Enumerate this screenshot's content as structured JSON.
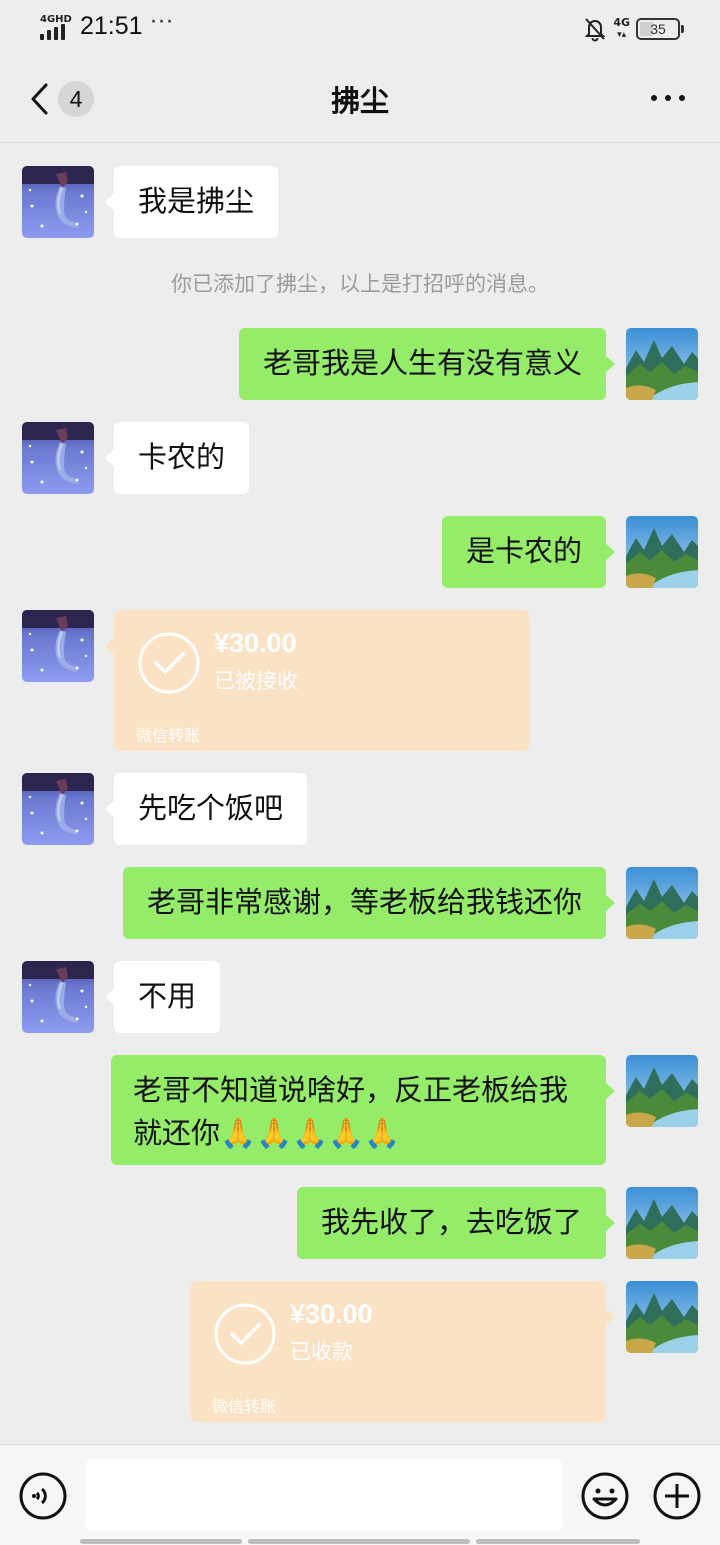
{
  "status_bar": {
    "network_type": "4GHD",
    "time": "21:51",
    "more": "···",
    "net_right": "4G",
    "battery": "35"
  },
  "nav": {
    "unread_count": "4",
    "title": "拂尘"
  },
  "messages": {
    "m1": "我是拂尘",
    "system": "你已添加了拂尘，以上是打招呼的消息。",
    "m2": "老哥我是人生有没有意义",
    "m3": "卡农的",
    "m4": "是卡农的",
    "t1": {
      "amount": "¥30.00",
      "status": "已被接收",
      "label": "微信转账"
    },
    "m5": "先吃个饭吧",
    "m6": "老哥非常感谢，等老板给我钱还你",
    "m7": "不用",
    "m8": "老哥不知道说啥好，反正老板给我就还你🙏🙏🙏🙏🙏",
    "m9": "我先收了，去吃饭了",
    "t2": {
      "amount": "¥30.00",
      "status": "已收款",
      "label": "微信转账"
    }
  },
  "icons": {
    "back": "chevron-left-icon",
    "more": "more-horizontal-icon",
    "voice": "voice-icon",
    "emoji": "emoji-icon",
    "plus": "plus-icon",
    "check": "check-circle-icon"
  },
  "colors": {
    "background": "#ededed",
    "outgoing_bubble": "#95ec69",
    "incoming_bubble": "#ffffff",
    "transfer_bubble": "#fbe2c5"
  }
}
